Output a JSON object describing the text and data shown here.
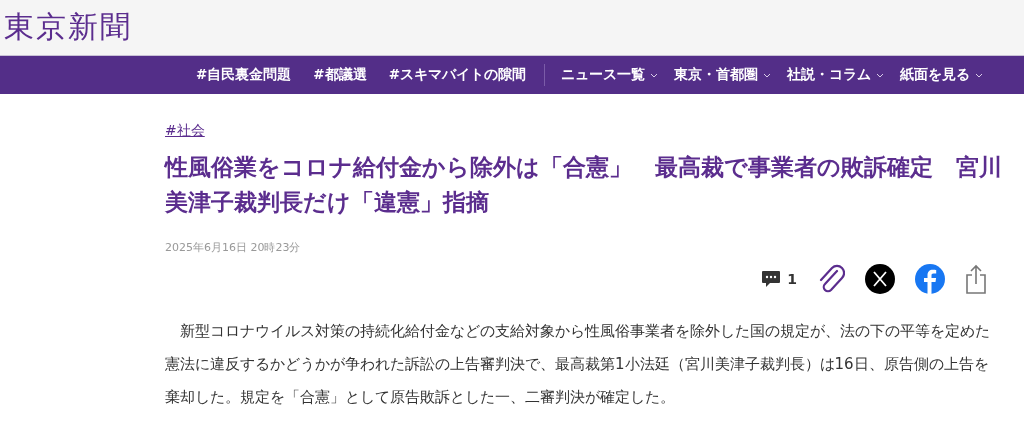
{
  "header": {
    "logo": "東京新聞"
  },
  "nav": [
    {
      "label": "#自民裏金問題",
      "kind": "tag"
    },
    {
      "label": "#都議選",
      "kind": "tag"
    },
    {
      "label": "#スキマバイトの隙間",
      "kind": "tag"
    },
    {
      "label": "ニュース一覧",
      "kind": "menu"
    },
    {
      "label": "東京・首都圏",
      "kind": "menu"
    },
    {
      "label": "社説・コラム",
      "kind": "menu"
    },
    {
      "label": "紙面を見る",
      "kind": "menu"
    }
  ],
  "article": {
    "category": "#社会",
    "headline": "性風俗業をコロナ給付金から除外は「合憲」　最高裁で事業者の敗訴確定　宮川美津子裁判長だけ「違憲」指摘",
    "date": "2025年6月16日 20時23分",
    "comment_count": "1",
    "body": "新型コロナウイルス対策の持続化給付金などの支給対象から性風俗事業者を除外した国の規定が、法の下の平等を定めた憲法に違反するかどうかが争われた訴訟の上告審判決で、最高裁第1小法廷（宮川美津子裁判長）は16日、原告側の上告を棄却した。規定を「合憲」として原告敗訴とした一、二審判決が確定した。"
  }
}
